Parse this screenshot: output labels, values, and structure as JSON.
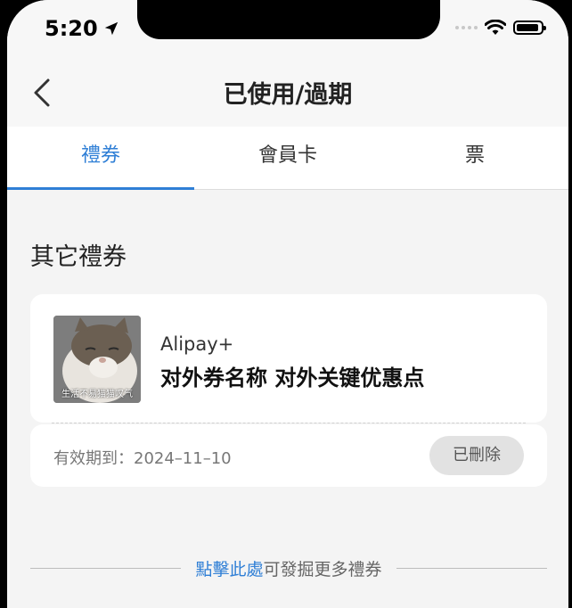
{
  "status_bar": {
    "time": "5:20"
  },
  "navbar": {
    "title": "已使用/過期"
  },
  "tabs": [
    {
      "label": "禮券",
      "active": true
    },
    {
      "label": "會員卡",
      "active": false
    },
    {
      "label": "票",
      "active": false
    }
  ],
  "section": {
    "title": "其它禮券"
  },
  "coupon": {
    "thumbnail_caption": "生活不易猫猫叹气",
    "brand": "Alipay+",
    "name": "对外券名称 对外关键优惠点",
    "validity": "有效期到：2024–11–10",
    "status": "已刪除"
  },
  "footer": {
    "link_text": "點擊此處",
    "suffix_text": "可發掘更多禮券"
  },
  "colors": {
    "accent": "#2f7fd6",
    "background": "#f4f4f4"
  }
}
